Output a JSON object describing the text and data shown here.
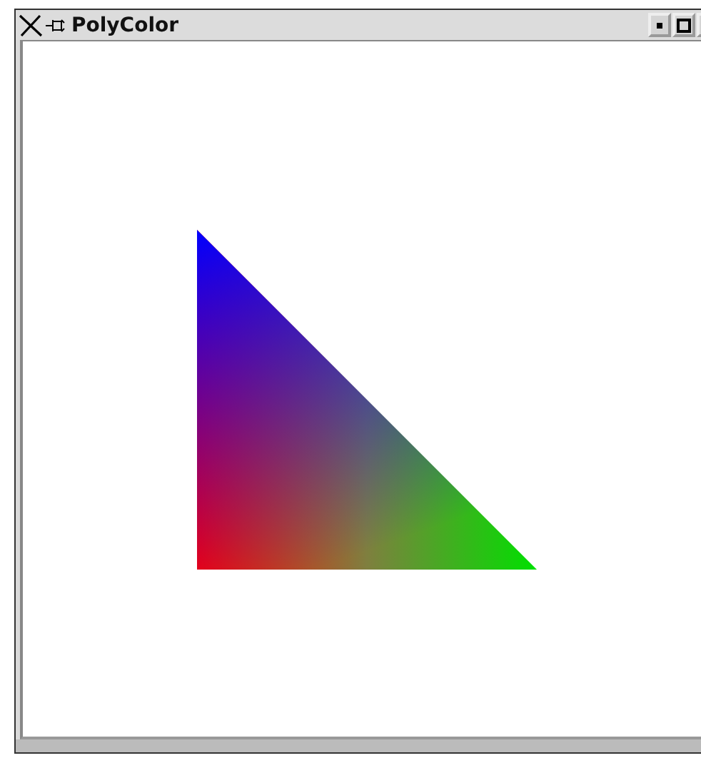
{
  "window": {
    "title": "PolyColor"
  }
}
